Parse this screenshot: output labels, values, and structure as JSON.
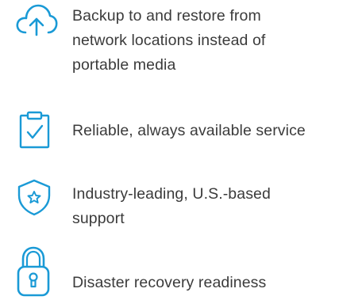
{
  "accent_color": "#1a9ad6",
  "features": [
    {
      "icon": "cloud-upload-icon",
      "lines": [
        "Backup to and restore from",
        "network locations instead of",
        "portable media"
      ]
    },
    {
      "icon": "clipboard-check-icon",
      "lines": [
        "Reliable, always available service"
      ]
    },
    {
      "icon": "shield-star-icon",
      "lines": [
        "Industry-leading, U.S.-based",
        "support"
      ]
    },
    {
      "icon": "padlock-icon",
      "lines": [
        "Disaster recovery readiness"
      ]
    }
  ]
}
